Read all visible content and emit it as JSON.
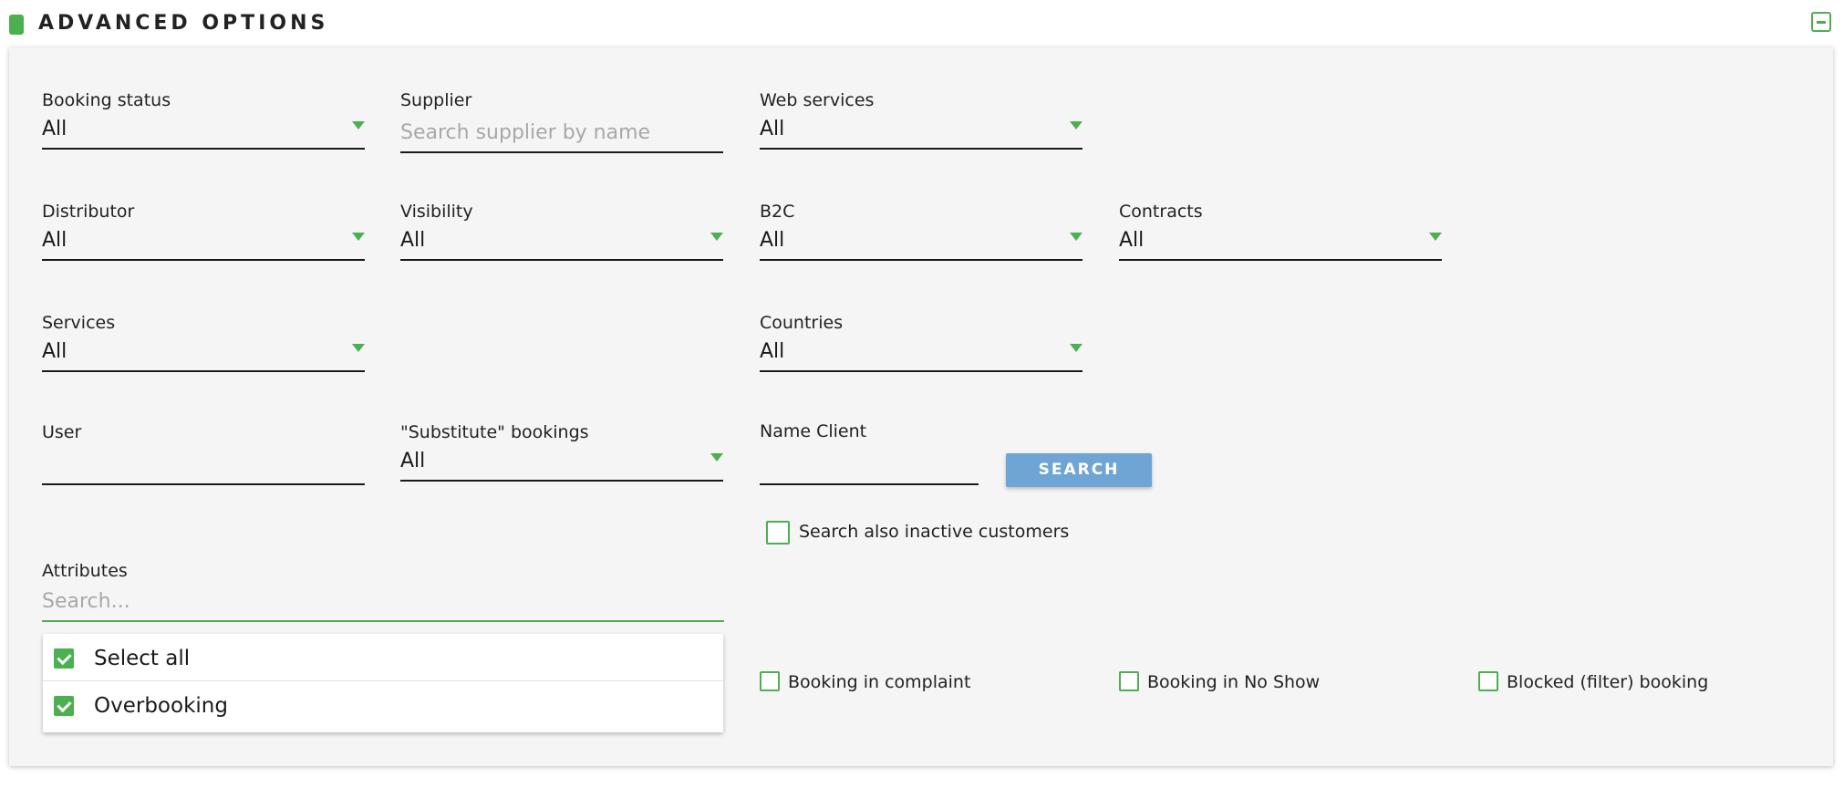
{
  "header": {
    "title": "ADVANCED OPTIONS"
  },
  "fields": {
    "booking_status": {
      "label": "Booking status",
      "value": "All"
    },
    "supplier": {
      "label": "Supplier",
      "placeholder": "Search supplier by name"
    },
    "web_services": {
      "label": "Web services",
      "value": "All"
    },
    "distributor": {
      "label": "Distributor",
      "value": "All"
    },
    "visibility": {
      "label": "Visibility",
      "value": "All"
    },
    "b2c": {
      "label": "B2C",
      "value": "All"
    },
    "contracts": {
      "label": "Contracts",
      "value": "All"
    },
    "services": {
      "label": "Services",
      "value": "All"
    },
    "countries": {
      "label": "Countries",
      "value": "All"
    },
    "user": {
      "label": "User",
      "value": ""
    },
    "substitute": {
      "label": "\"Substitute\" bookings",
      "value": "All"
    },
    "name_client": {
      "label": "Name Client",
      "value": ""
    },
    "attributes": {
      "label": "Attributes",
      "placeholder": "Search..."
    }
  },
  "search_button": "SEARCH",
  "checkboxes": {
    "inactive_customers": "Search also inactive customers",
    "complaint": "Booking in complaint",
    "no_show": "Booking in No Show",
    "blocked": "Blocked (filter) booking"
  },
  "attribute_options": [
    "Select all",
    "Overbooking"
  ],
  "colors": {
    "accent": "#4caf50",
    "button": "#6fa5d5",
    "panel": "#f5f5f5"
  }
}
